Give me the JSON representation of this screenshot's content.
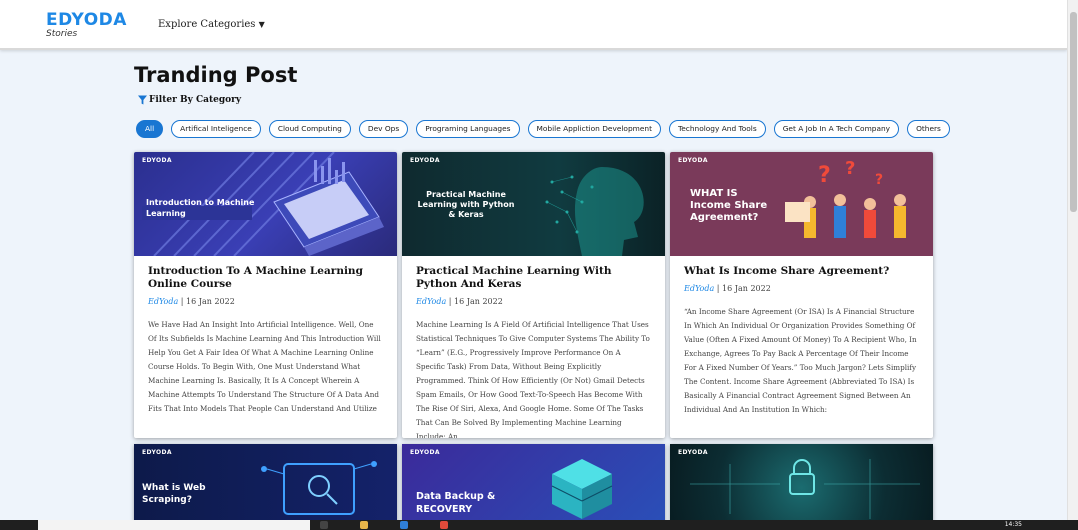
{
  "header": {
    "brand": "EDYODA",
    "brand_sub": "Stories",
    "explore_label": "Explore Categories"
  },
  "main": {
    "title": "Tranding Post",
    "filter_label": "Filter By Category",
    "chips": [
      "All",
      "Artifical Inteligence",
      "Cloud Computing",
      "Dev Ops",
      "Programing Languages",
      "Mobile Appliction Development",
      "Technology And Tools",
      "Get A Job In A Tech Company",
      "Others"
    ],
    "active_chip": "All"
  },
  "posts": [
    {
      "thumb_logo": "EDYODA",
      "thumb_title": "Introduction to Machine Learning",
      "title": "Introduction To A Machine Learning Online Course",
      "author": "EdYoda",
      "date": "16 Jan 2022",
      "excerpt": "We Have Had An Insight Into Artificial Intelligence. Well, One Of Its Subfields Is Machine Learning And This Introduction Will Help You Get A Fair Idea Of What A Machine Learning Online Course Holds. To Begin With, One Must Understand What Machine Learning Is. Basically, It Is A Concept Wherein A Machine Attempts To Understand The Structure Of A Data And Fits That Into Models That People Can Understand And Utilize"
    },
    {
      "thumb_logo": "EDYODA",
      "thumb_title": "Practical Machine Learning with Python & Keras",
      "title": "Practical Machine Learning With Python And Keras",
      "author": "EdYoda",
      "date": "16 Jan 2022",
      "excerpt": "Machine Learning Is A Field Of Artificial Intelligence That Uses Statistical Techniques To Give Computer Systems The Ability To “Learn” (E.G., Progressively Improve Performance On A Specific Task) From Data, Without Being Explicitly Programmed. Think Of How Efficiently (Or Not) Gmail Detects Spam Emails, Or How Good Text-To-Speech Has Become With The Rise Of Siri, Alexa, And Google Home. Some Of The Tasks That Can Be Solved By Implementing Machine Learning Include: An"
    },
    {
      "thumb_logo": "EDYODA",
      "thumb_title": "WHAT IS Income Share Agreement?",
      "title": "What Is Income Share Agreement?",
      "author": "EdYoda",
      "date": "16 Jan 2022",
      "excerpt": "“An Income Share Agreement (Or ISA) Is A Financial Structure In Which An Individual Or Organization Provides Something Of Value (Often A Fixed Amount Of Money) To A Recipient Who, In Exchange, Agrees To Pay Back A Percentage Of Their Income For A Fixed Number Of Years.” Too Much Jargon? Lets Simplify The Content. Income Share Agreement (Abbreviated To ISA) Is Basically A Financial Contract Agreement Signed Between An Individual And An Institution In Which:"
    }
  ],
  "posts_row2": [
    {
      "thumb_logo": "EDYODA",
      "thumb_title": "What is Web Scraping?"
    },
    {
      "thumb_logo": "EDYODA",
      "thumb_title": "Data Backup & RECOVERY"
    },
    {
      "thumb_logo": "EDYODA",
      "thumb_title": ""
    }
  ],
  "taskbar": {
    "time": "14:35"
  },
  "colors": {
    "accent": "#1976d2",
    "brand": "#1e88e5",
    "background": "#eef4fb"
  }
}
